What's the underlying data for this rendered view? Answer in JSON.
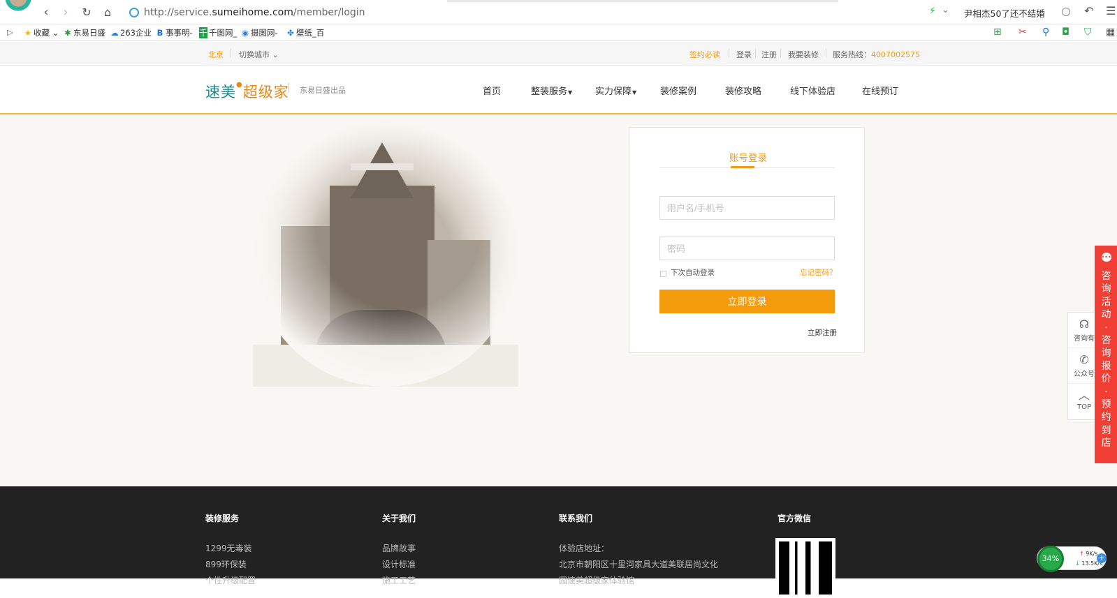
{
  "browser": {
    "url_prefix": "http://service.",
    "url_domain": "sumeihome.com",
    "url_path": "/member/login",
    "search_hint": "尹相杰50了还不结婚",
    "bookmarks": [
      "收藏",
      "东易日盛",
      "263企业",
      "事事明-",
      "千图网_",
      "摄图网-",
      "壁纸_百"
    ]
  },
  "topbar": {
    "city": "北京",
    "switch_city": "切换城市",
    "links": [
      "签约必读",
      "登录",
      "注册",
      "我要装修"
    ],
    "hotline_label": "服务热线：",
    "hotline_number": "4007002575"
  },
  "header": {
    "logo_part1": "速美",
    "logo_part2": "超级家",
    "slogan": "东易日盛出品",
    "nav": [
      "首页",
      "整装服务",
      "实力保障",
      "装修案例",
      "装修攻略",
      "线下体验店",
      "在线预订"
    ]
  },
  "login": {
    "tab_label": "账号登录",
    "username_placeholder": "用户名/手机号",
    "password_placeholder": "密码",
    "remember_label": "下次自动登录",
    "forgot_link": "忘记密码？",
    "submit_label": "立即登录",
    "register_link": "立即注册"
  },
  "side": {
    "items": [
      "咨询有",
      "公众号",
      "TOP"
    ],
    "promo_text": "咨询活动·咨询报价·预约到店"
  },
  "footer": {
    "columns": [
      {
        "title": "装修服务",
        "links": [
          "1299无毒装",
          "899环保装",
          "个性升级配置"
        ]
      },
      {
        "title": "关于我们",
        "links": [
          "品牌故事",
          "设计标准",
          "施工工艺"
        ]
      },
      {
        "title": "联系我们",
        "links": [
          "体验店地址：",
          "北京市朝阳区十里河家具大道美联居尚文化",
          "园速美超级家体验馆"
        ]
      },
      {
        "title": "官方微信",
        "links": []
      }
    ]
  },
  "net_widget": {
    "percent": "34%",
    "up": "9K/s",
    "down": "13.5K/s"
  }
}
